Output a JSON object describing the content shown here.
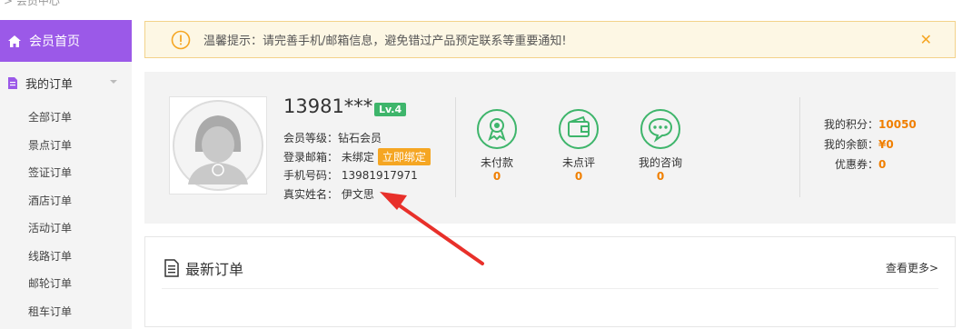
{
  "breadcrumb": "> 会员中心",
  "sidebar": {
    "home_label": "会员首页",
    "orders_label": "我的订单",
    "sub_items": [
      "全部订单",
      "景点订单",
      "签证订单",
      "酒店订单",
      "活动订单",
      "线路订单",
      "邮轮订单",
      "租车订单"
    ],
    "accent_color": "#9b59e8"
  },
  "notice": {
    "text": "温馨提示：请完善手机/邮箱信息，避免错过产品预定联系等重要通知!",
    "close": "✕"
  },
  "profile": {
    "username": "13981***",
    "level_badge": "Lv.4",
    "member_level": "会员等级：钻石会员",
    "email": "登录邮箱： 未绑定",
    "bind_button": "立即绑定",
    "phone": "手机号码： 13981917971",
    "real_name": "真实姓名： 伊文思"
  },
  "stats": [
    {
      "label": "未付款",
      "value": "0",
      "icon": "award-icon"
    },
    {
      "label": "未点评",
      "value": "0",
      "icon": "wallet-icon"
    },
    {
      "label": "我的咨询",
      "value": "0",
      "icon": "chat-icon"
    }
  ],
  "account": {
    "points_label": "我的积分：",
    "points_value": "10050",
    "balance_label": "我的余额：",
    "balance_value": "¥0",
    "coupon_label": "优惠券：",
    "coupon_value": "0"
  },
  "orders": {
    "title": "最新订单",
    "more": "查看更多>"
  }
}
